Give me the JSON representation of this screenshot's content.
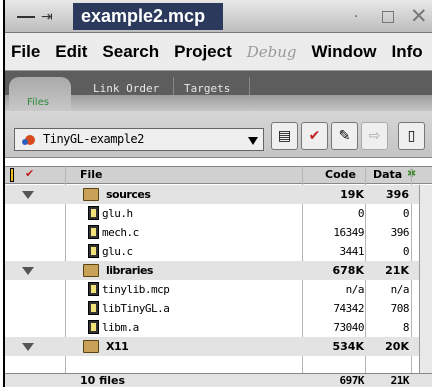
{
  "window": {
    "title": "example2.mcp"
  },
  "menu": [
    "File",
    "Edit",
    "Search",
    "Project",
    "Debug",
    "Window",
    "Info"
  ],
  "tabs": {
    "active": "Files",
    "others": [
      "Link Order",
      "Targets"
    ]
  },
  "target": {
    "selected": "TinyGL-example2"
  },
  "table": {
    "columns": {
      "file": "File",
      "code": "Code",
      "data": "Data"
    },
    "rows": [
      {
        "kind": "group",
        "name": "sources",
        "code": "19K",
        "data": "396"
      },
      {
        "kind": "file",
        "name": "glu.h",
        "code": "0",
        "data": "0"
      },
      {
        "kind": "file",
        "name": "mech.c",
        "code": "16349",
        "data": "396"
      },
      {
        "kind": "file",
        "name": "glu.c",
        "code": "3441",
        "data": "0"
      },
      {
        "kind": "group",
        "name": "libraries",
        "code": "678K",
        "data": "21K"
      },
      {
        "kind": "file",
        "name": "tinylib.mcp",
        "code": "n/a",
        "data": "n/a"
      },
      {
        "kind": "file",
        "name": "libTinyGL.a",
        "code": "74342",
        "data": "708"
      },
      {
        "kind": "file",
        "name": "libm.a",
        "code": "73040",
        "data": "8"
      },
      {
        "kind": "group",
        "name": "X11",
        "code": "534K",
        "data": "20K"
      }
    ],
    "footer": {
      "label": "10 files",
      "code": "697K",
      "data": "21K"
    }
  }
}
